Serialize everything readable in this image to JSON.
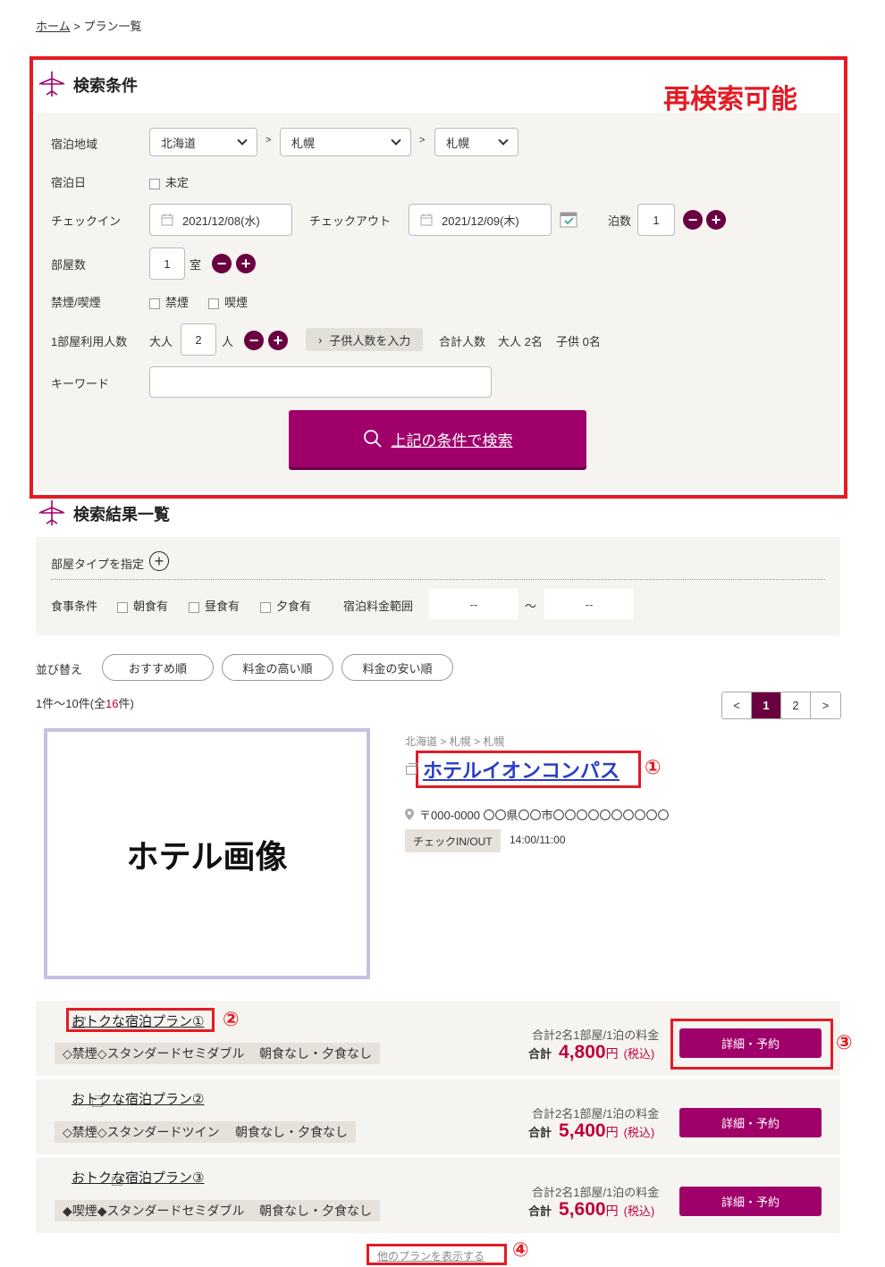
{
  "breadcrumb": {
    "home": "ホーム",
    "sep": ">",
    "current": "プラン一覧"
  },
  "search": {
    "title": "検索条件",
    "recheck_label": "再検索可能",
    "area_label": "宿泊地域",
    "area_1": "北海道",
    "area_2": "札幌",
    "area_3": "札幌",
    "arrow": ">",
    "date_label": "宿泊日",
    "undecided": "未定",
    "checkin_label": "チェックイン",
    "checkin_value": "2021/12/08(水)",
    "checkout_label": "チェックアウト",
    "checkout_value": "2021/12/09(木)",
    "nights_label": "泊数",
    "nights_value": "1",
    "rooms_label": "部屋数",
    "rooms_value": "1",
    "rooms_unit": "室",
    "smoke_label": "禁煙/喫煙",
    "no_smoking": "禁煙",
    "smoking": "喫煙",
    "people_label": "1部屋利用人数",
    "adult_label": "大人",
    "adult_value": "2",
    "adult_unit": "人",
    "child_button": "子供人数を入力",
    "total_label": "合計人数",
    "total_adult": "大人 2名",
    "total_child": "子供 0名",
    "keyword_label": "キーワード",
    "keyword_value": "",
    "submit_label": "上記の条件で検索",
    "minus": "−",
    "plus": "+"
  },
  "results": {
    "title": "検索結果一覧",
    "room_type_label": "部屋タイプを指定",
    "meal_label": "食事条件",
    "meal_breakfast": "朝食有",
    "meal_lunch": "昼食有",
    "meal_dinner": "夕食有",
    "price_range_label": "宿泊料金範囲",
    "price_min": "--",
    "price_tilde": "～",
    "price_max": "--",
    "sort_label": "並び替え",
    "sort_recommend": "おすすめ順",
    "sort_high": "料金の高い順",
    "sort_low": "料金の安い順",
    "count_prefix": "1件～10件(全",
    "count_total": "16",
    "count_suffix": "件)",
    "pager": {
      "prev": "<",
      "page1": "1",
      "page2": "2",
      "next": ">"
    }
  },
  "hotel": {
    "image_label": "ホテル画像",
    "area_path": "北海道 > 札幌 > 札幌",
    "name": "ホテルイオンコンパス",
    "marker_1": "①",
    "address": "〒000-0000 〇〇県〇〇市〇〇〇〇〇〇〇〇〇〇",
    "checkin_tag": "チェックIN/OUT",
    "checkin_time": "14:00/11:00"
  },
  "plans": [
    {
      "name": "おトクな宿泊プラン①",
      "room": "◇禁煙◇スタンダードセミダブル",
      "meal": "朝食なし・夕食なし",
      "note": "合計2名1部屋/1泊の料金",
      "total_label": "合計",
      "price": "4,800",
      "unit": "円",
      "tax": "(税込)",
      "button": "詳細・予約"
    },
    {
      "name": "おトクな宿泊プラン②",
      "room": "◇禁煙◇スタンダードツイン",
      "meal": "朝食なし・夕食なし",
      "note": "合計2名1部屋/1泊の料金",
      "total_label": "合計",
      "price": "5,400",
      "unit": "円",
      "tax": "(税込)",
      "button": "詳細・予約"
    },
    {
      "name": "おトクな宿泊プラン③",
      "room": "◆喫煙◆スタンダードセミダブル",
      "meal": "朝食なし・夕食なし",
      "note": "合計2名1部屋/1泊の料金",
      "total_label": "合計",
      "price": "5,600",
      "unit": "円",
      "tax": "(税込)",
      "button": "詳細・予約"
    }
  ],
  "markers": {
    "m2": "②",
    "m3": "③",
    "m4": "④"
  },
  "more_plans": "他のプランを表示する"
}
